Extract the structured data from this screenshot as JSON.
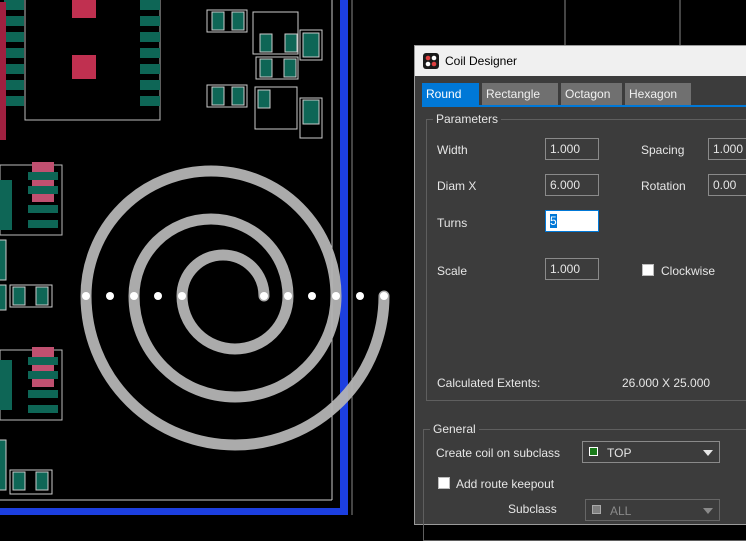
{
  "window": {
    "title": "Coil Designer",
    "icon": "coil-designer-app-icon"
  },
  "tabs": [
    {
      "label": "Round",
      "active": true
    },
    {
      "label": "Rectangle",
      "active": false
    },
    {
      "label": "Octagon",
      "active": false
    },
    {
      "label": "Hexagon",
      "active": false
    }
  ],
  "parameters": {
    "group_title": "Parameters",
    "width": {
      "label": "Width",
      "value": "1.000"
    },
    "spacing": {
      "label": "Spacing",
      "value": "1.000"
    },
    "diam_x": {
      "label": "Diam X",
      "value": "6.000"
    },
    "rotation": {
      "label": "Rotation",
      "value": "0.00"
    },
    "turns": {
      "label": "Turns",
      "value": "5"
    },
    "scale": {
      "label": "Scale",
      "value": "1.000"
    },
    "clockwise": {
      "label": "Clockwise",
      "checked": false
    },
    "extents": {
      "label": "Calculated Extents:",
      "value": "26.000 X 25.000"
    }
  },
  "general": {
    "group_title": "General",
    "subclass_combo": {
      "label": "Create coil on subclass",
      "value": "TOP",
      "swatch_color": "#1a7a1a"
    },
    "route_keepout": {
      "label": "Add route keepout",
      "checked": false
    },
    "subclass": {
      "label": "Subclass",
      "value": "ALL",
      "swatch_color": "#808080"
    }
  },
  "colors": {
    "coil": "#b4b4b4",
    "board_outline": "#1c3fe0",
    "pad": "#0e6656",
    "accent": "#0078d7"
  }
}
